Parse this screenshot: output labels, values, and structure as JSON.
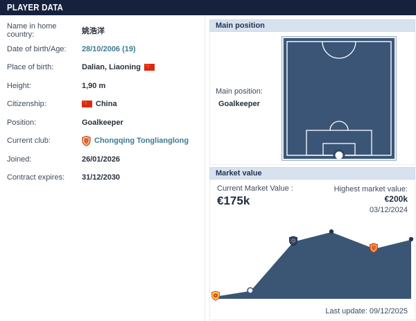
{
  "header": {
    "title": "PLAYER DATA"
  },
  "player_info": {
    "rows": [
      {
        "label": "Name in home country:",
        "value": "姚浩洋"
      },
      {
        "label": "Date of birth/Age:",
        "value": "28/10/2006 (19)"
      },
      {
        "label": "Place of birth:",
        "value": "Dalian, Liaoning",
        "flag": "china-flag"
      },
      {
        "label": "Height:",
        "value": "1,90 m"
      },
      {
        "label": "Citizenship:",
        "value": "China",
        "flag": "china-flag"
      },
      {
        "label": "Position:",
        "value": "Goalkeeper"
      },
      {
        "label": "Current club:",
        "value": "Chongqing Tonglianglong",
        "badge": "club-badge-orange"
      },
      {
        "label": "Joined:",
        "value": "26/01/2026"
      },
      {
        "label": "Contract expires:",
        "value": "31/12/2030"
      }
    ]
  },
  "main_position": {
    "header": "Main position",
    "label": "Main position:",
    "value": "Goalkeeper"
  },
  "market_value": {
    "header": "Market value",
    "current_label": "Current Market Value :",
    "current_value": "€175k",
    "highest_label": "Highest market value:",
    "highest_value": "€200k",
    "highest_date": "03/12/2024",
    "last_update": "Last update: 09/12/2025"
  },
  "chart_data": {
    "type": "area",
    "title": "Market value development",
    "unit": "EUR thousands",
    "ylim": [
      0,
      220
    ],
    "grid": false,
    "legend": false,
    "line_color": "#ffffff",
    "fill_color": "#3b5574",
    "points": [
      {
        "value_eur_k": 10,
        "marker": "club-badge-gold-red"
      },
      {
        "value_eur_k": 25,
        "marker": "open-dot"
      },
      {
        "value_eur_k": 175,
        "marker": "club-badge-navy"
      },
      {
        "value_eur_k": 200,
        "marker": "dot",
        "date": "03/12/2024",
        "note": "highest market value"
      },
      {
        "value_eur_k": 150,
        "marker": "club-badge-orange"
      },
      {
        "value_eur_k": 175,
        "marker": "dot",
        "date": "09/12/2025",
        "note": "current market value / last update"
      }
    ]
  },
  "colors": {
    "header_bg": "#16213e",
    "section_bar_bg": "#d8e2ee",
    "section_text": "#1f3354",
    "link": "#3c7b93",
    "field_fill": "#3b5577",
    "chart_fill": "#3b5574",
    "accent_orange": "#e2622b",
    "flag_red": "#de2910",
    "flag_yellow": "#ffde00"
  }
}
